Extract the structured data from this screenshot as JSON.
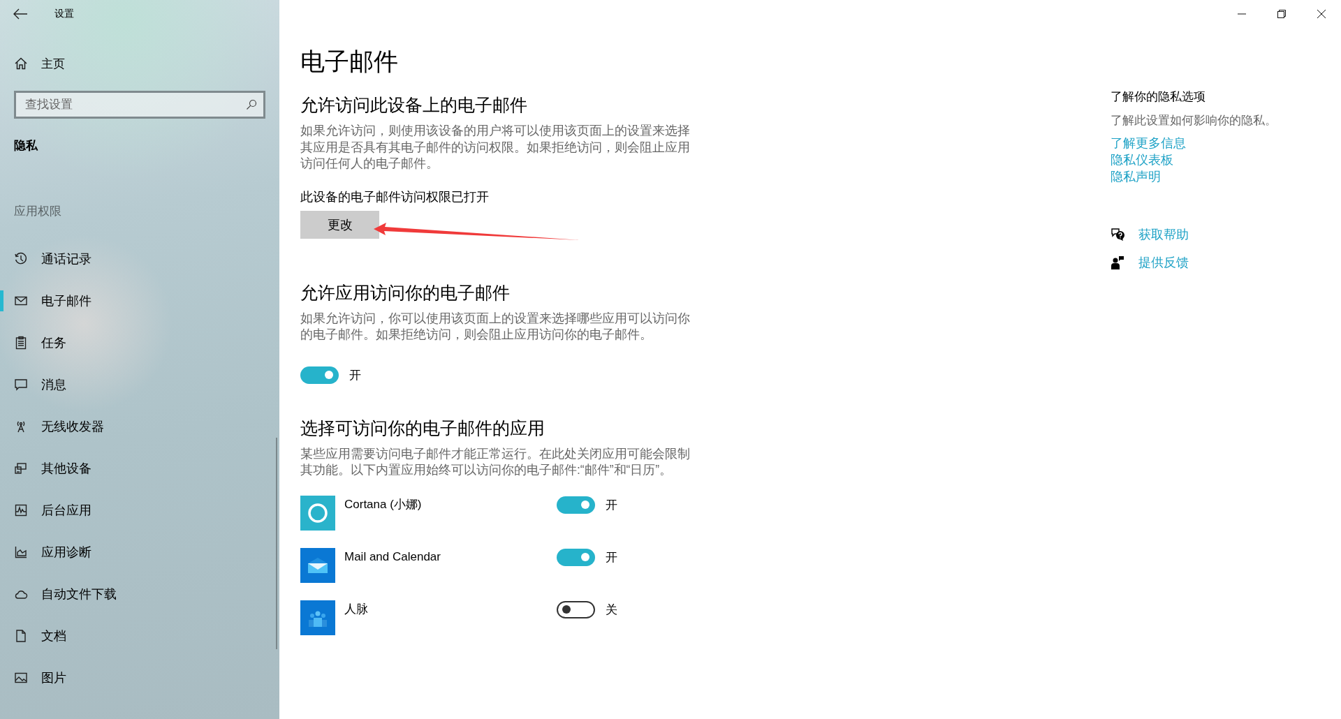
{
  "window": {
    "title": "设置"
  },
  "sidebar": {
    "home": "主页",
    "search": {
      "placeholder": "查找设置"
    },
    "section": "隐私",
    "group": "应用权限",
    "items": [
      {
        "label": "通话记录",
        "kind": "history",
        "selected": false
      },
      {
        "label": "电子邮件",
        "kind": "mail",
        "selected": true
      },
      {
        "label": "任务",
        "kind": "clipboard",
        "selected": false
      },
      {
        "label": "消息",
        "kind": "chat",
        "selected": false
      },
      {
        "label": "无线收发器",
        "kind": "antenna",
        "selected": false
      },
      {
        "label": "其他设备",
        "kind": "devices",
        "selected": false
      },
      {
        "label": "后台应用",
        "kind": "activity",
        "selected": false
      },
      {
        "label": "应用诊断",
        "kind": "chart",
        "selected": false
      },
      {
        "label": "自动文件下载",
        "kind": "cloud",
        "selected": false
      },
      {
        "label": "文档",
        "kind": "document",
        "selected": false
      },
      {
        "label": "图片",
        "kind": "image",
        "selected": false
      }
    ]
  },
  "page": {
    "title": "电子邮件",
    "device_access": {
      "heading": "允许访问此设备上的电子邮件",
      "description": "如果允许访问，则使用该设备的用户将可以使用该页面上的设置来选择其应用是否具有其电子邮件的访问权限。如果拒绝访问，则会阻止应用访问任何人的电子邮件。",
      "status": "此设备的电子邮件访问权限已打开",
      "button": "更改"
    },
    "app_access": {
      "heading": "允许应用访问你的电子邮件",
      "description": "如果允许访问，你可以使用该页面上的设置来选择哪些应用可以访问你的电子邮件。如果拒绝访问，则会阻止应用访问你的电子邮件。",
      "toggle": {
        "on": true,
        "label": "开"
      }
    },
    "apps_section": {
      "heading": "选择可访问你的电子邮件的应用",
      "description": "某些应用需要访问电子邮件才能正常运行。在此处关闭应用可能会限制其功能。以下内置应用始终可以访问你的电子邮件:“邮件”和“日历”。",
      "apps": [
        {
          "name": "Cortana (小娜)",
          "kind": "cortana",
          "on": true,
          "label": "开"
        },
        {
          "name": "Mail and Calendar",
          "kind": "mail",
          "on": true,
          "label": "开"
        },
        {
          "name": "人脉",
          "kind": "people",
          "on": false,
          "label": "关"
        }
      ]
    }
  },
  "aside": {
    "heading": "了解你的隐私选项",
    "description": "了解此设置如何影响你的隐私。",
    "links": [
      "了解更多信息",
      "隐私仪表板",
      "隐私声明"
    ],
    "actions": [
      {
        "label": "获取帮助",
        "kind": "help"
      },
      {
        "label": "提供反馈",
        "kind": "feedback"
      }
    ]
  }
}
